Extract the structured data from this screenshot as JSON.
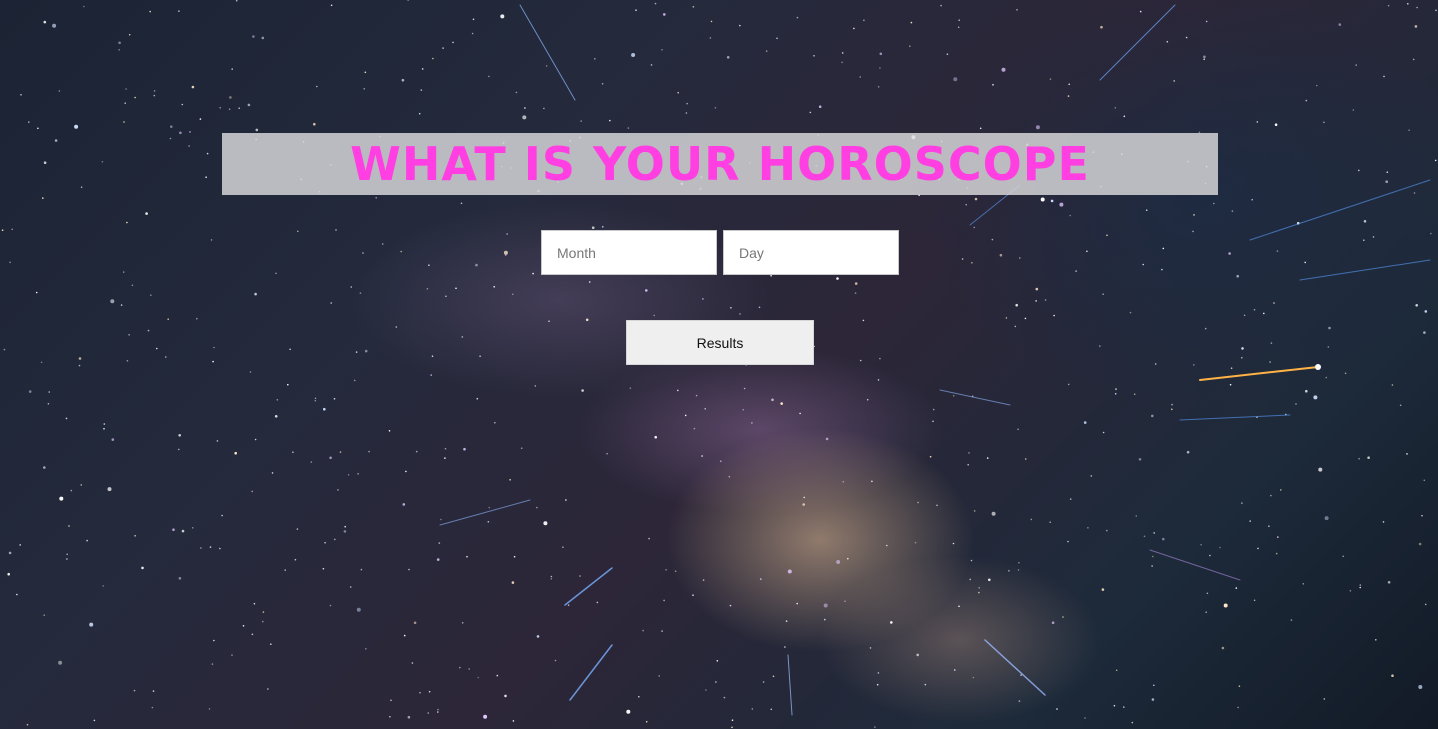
{
  "header": {
    "title": "WHAT IS YOUR HOROSCOPE"
  },
  "form": {
    "month": {
      "placeholder": "Month",
      "value": ""
    },
    "day": {
      "placeholder": "Day",
      "value": ""
    },
    "submit_label": "Results"
  },
  "colors": {
    "title": "#ff3fe1",
    "title_background": "#dcdcde",
    "button_background": "#efefef"
  }
}
